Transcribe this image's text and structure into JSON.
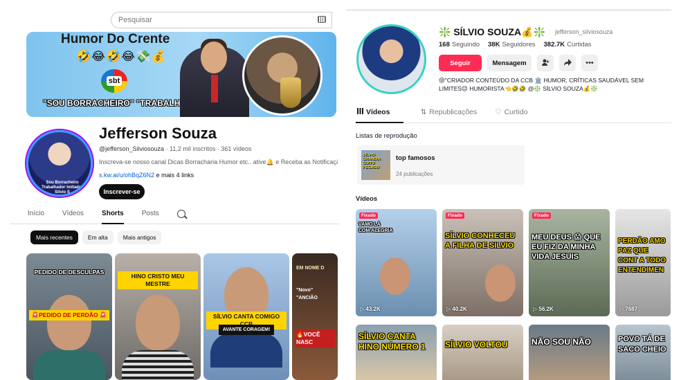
{
  "youtube": {
    "search_placeholder": "Pesquisar",
    "banner": {
      "title": "Humor Do Crente",
      "emojis": "🤣😂🤣😂💸💰",
      "logo": "sbt",
      "slogan": "\"SOU BORRACHEIRO\" \"TRABALHADOR\""
    },
    "avatar_caption": "Sou Borracheiro Trabalhador Imitador Silvio S",
    "channel_name": "Jefferson Souza",
    "handle": "@jefferson_Silviosouza",
    "subscribers": "11,2 mil inscritos",
    "videos": "361 vídeos",
    "description": "Inscreva-se nosso canal Dicas Borracharia Humor etc.. ative🔔 e Receba as Notificação...r",
    "link": "s.kw.ai/u/ohBqZ6N2",
    "link_more": "e mais 4 links",
    "subscribe_label": "Inscrever-se",
    "tabs": [
      "Início",
      "Vídeos",
      "Shorts",
      "Posts"
    ],
    "active_tab": "Shorts",
    "chips": [
      "Mais recentes",
      "Em alta",
      "Mais antigos"
    ],
    "shorts": [
      {
        "caption_top": "PEDIDO DE DESCULPAS",
        "caption_mid": "🚨PEDIDO DE PERDÃO 🚨"
      },
      {
        "caption_top": "HINO CRISTO MEU MESTRE"
      },
      {
        "caption_top": "SÍLVIO CANTA COMIGO CCB",
        "caption_mid": "AVANTE CORAGEM!"
      },
      {
        "caption_top": "EM NOME D",
        "caption_mid": "\"Novo\" \"ANCIÃO",
        "caption_bot": "🔥VOCÊ NASC"
      }
    ]
  },
  "tiktok": {
    "display_name": "❇️ SÍLVIO SOUZA💰❇️",
    "username": "jefferson_silviosouza",
    "stats": [
      {
        "value": "168",
        "label": "Seguindo"
      },
      {
        "value": "38K",
        "label": "Seguidores"
      },
      {
        "value": "382.7K",
        "label": "Curtidas"
      }
    ],
    "follow_label": "Seguir",
    "message_label": "Mensagem",
    "bio": "😝\"CRIADOR CONTEÚDO DA CCB 🏛️ HUMOR, CRÍTICAS SAUDÁVEL SEM LIMITES😉 HUMORISTA👈🤣🤣 @❇️ SÍLVIO SOUZA💰❇️",
    "tabs": [
      "Vídeos",
      "Republicações",
      "Curtido"
    ],
    "active_tab": "Vídeos",
    "playlists_heading": "Listas de reprodução",
    "playlist": {
      "thumb_text": "SÍLVIO GRANDIA GUITO PEGADO",
      "title": "top famosos",
      "count": "24 publicações"
    },
    "videos_heading": "Vídeos",
    "pinned_label": "Fixado",
    "videos_row1": [
      {
        "pinned": true,
        "caption": "VAMO LÁ COM ALEGRIA",
        "views": "▷ 43.2K"
      },
      {
        "pinned": true,
        "caption": "SÍLVIO CONHECEU A FILHA DE SILVIO",
        "views": "▷ 40.2K"
      },
      {
        "pinned": true,
        "caption": "MEU DEUS 😱 QUE EU FIZ DA MINHA VIDA JESUIS",
        "views": "▷ 56.2K"
      },
      {
        "pinned": false,
        "caption": "PERDÃO AMO PAZ QUE CONT A TODO ENTENDIMEN",
        "views": "▷ 7687"
      }
    ],
    "videos_row2": [
      {
        "caption": "SÍLVIO CANTA HINO NÚMERO 1"
      },
      {
        "caption": "SÍLVIO VOLTOU"
      },
      {
        "caption": "NÃO SOU NÃO"
      },
      {
        "caption": "POVO TÁ DE SACO CHEIO"
      }
    ]
  }
}
